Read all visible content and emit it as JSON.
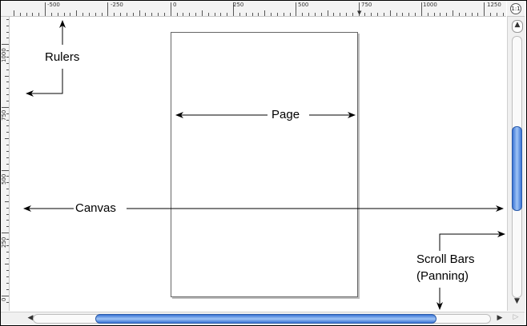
{
  "ruler": {
    "top_labels": [
      "-500",
      "-250",
      "0",
      "250",
      "500",
      "750",
      "1000",
      "1250"
    ],
    "left_labels": [
      "1000",
      "750",
      "500",
      "250",
      "0"
    ]
  },
  "zoom": {
    "label": "1:1"
  },
  "annotations": {
    "rulers": "Rulers",
    "page": "Page",
    "canvas": "Canvas",
    "scroll_bars_line1": "Scroll Bars",
    "scroll_bars_line2": "(Panning)"
  },
  "icons": {
    "scroll_up": "up-arrow",
    "scroll_down": "down-arrow",
    "scroll_left": "left-arrow",
    "scroll_right": "right-arrow",
    "zoom": "zoom-icon"
  },
  "colors": {
    "scroll_thumb": "#3a74d6",
    "page_border": "#666666",
    "ruler_bg": "#f3f3f3"
  }
}
